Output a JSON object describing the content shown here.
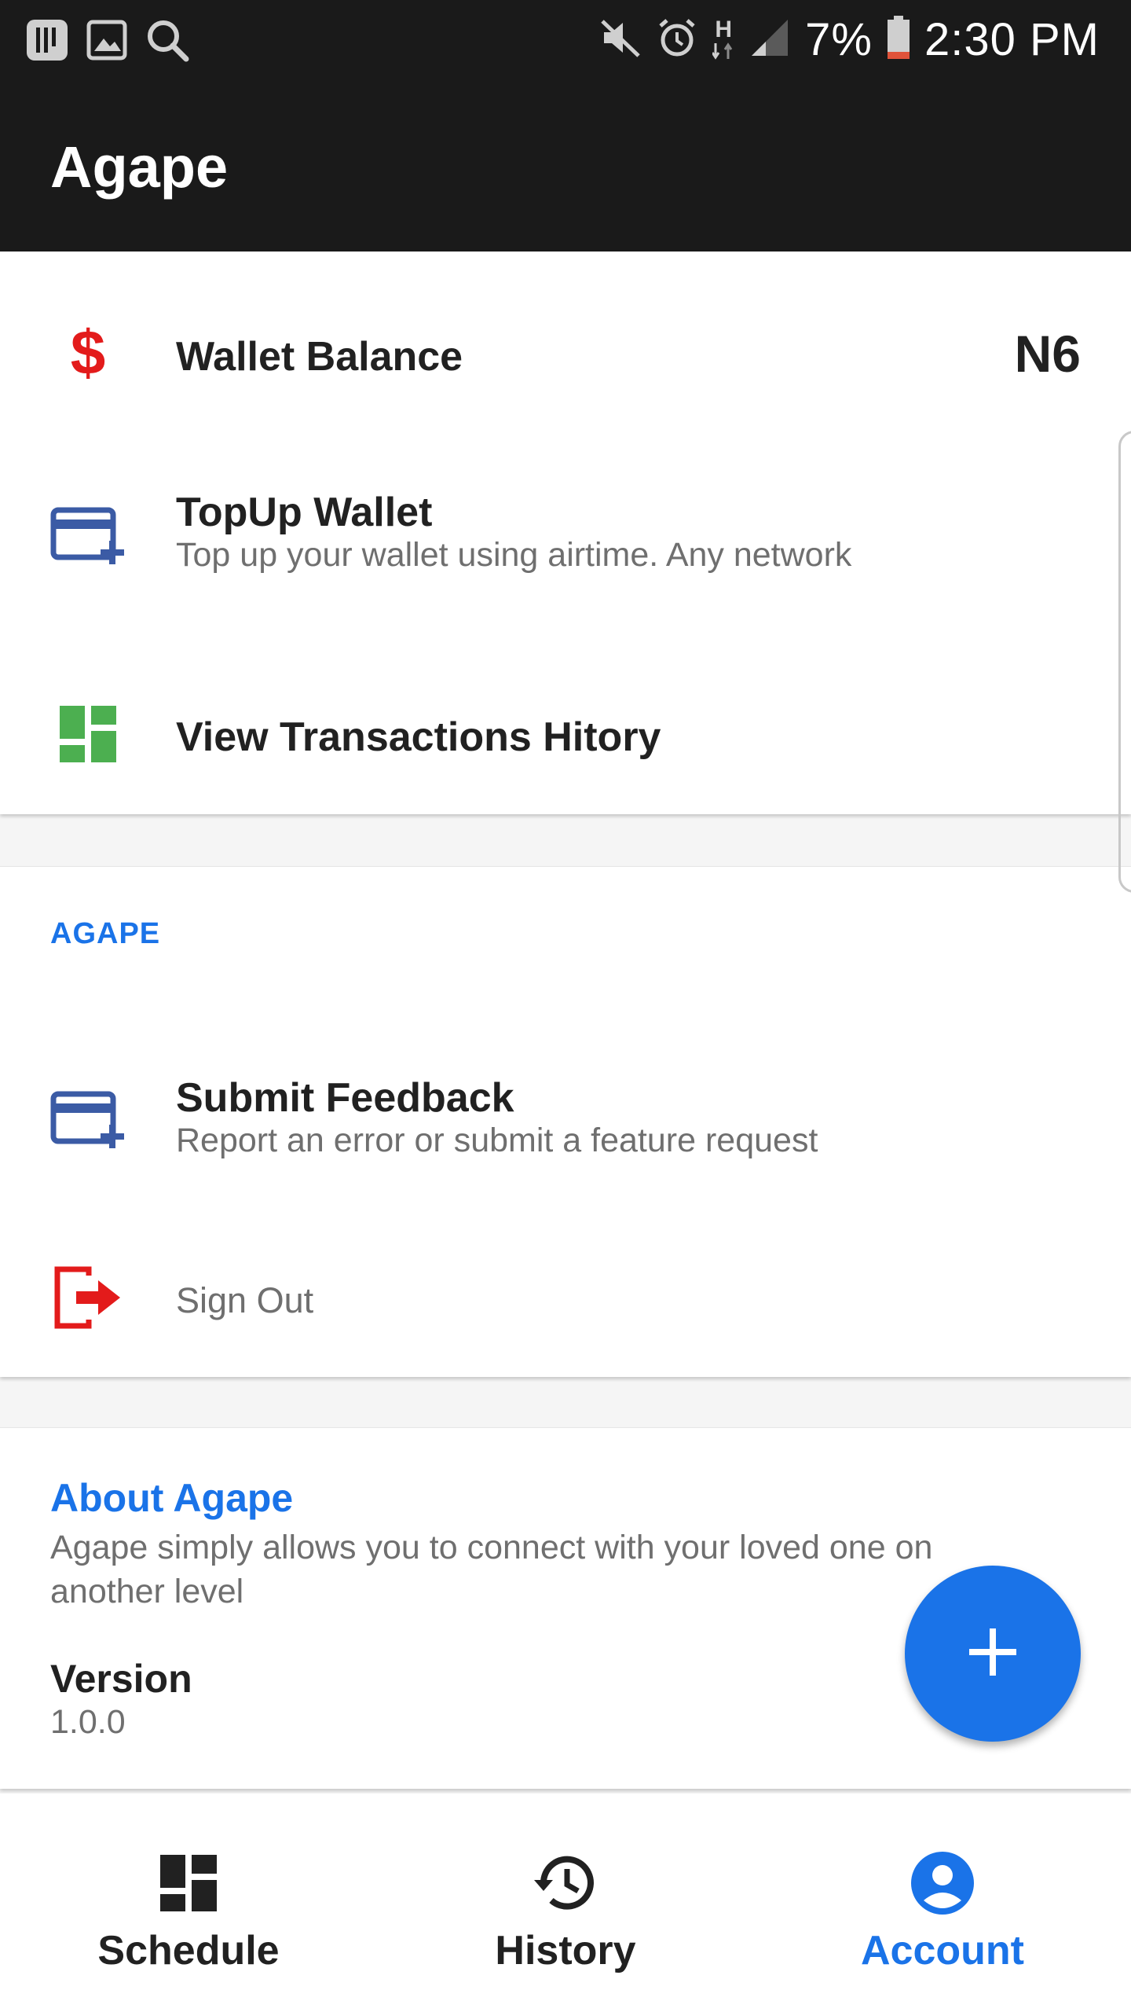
{
  "status_bar": {
    "battery": "7%",
    "time": "2:30 PM",
    "network_label": "H"
  },
  "app": {
    "title": "Agape"
  },
  "account_card": {
    "wallet_balance_label": "Wallet Balance",
    "wallet_balance_value": "N6",
    "topup_title": "TopUp Wallet",
    "topup_subtitle": "Top up your wallet using airtime. Any network",
    "transactions_title": "View Transactions Hitory"
  },
  "agape_section": {
    "header": "AGAPE",
    "feedback_title": "Submit Feedback",
    "feedback_subtitle": "Report an error or submit a feature request",
    "signout_label": "Sign Out"
  },
  "about_card": {
    "title": "About Agape",
    "description": "Agape simply allows you to connect with your loved one on another level",
    "version_label": "Version",
    "version_value": "1.0.0"
  },
  "bottom_nav": {
    "items": [
      {
        "label": "Schedule",
        "icon": "dashboard-icon",
        "active": false
      },
      {
        "label": "History",
        "icon": "history-icon",
        "active": false
      },
      {
        "label": "Account",
        "icon": "account-circle-icon",
        "active": true
      }
    ]
  },
  "colors": {
    "accent": "#1a73e8",
    "dollar": "#e31b1b",
    "card_icon": "#3b5ba5",
    "grid_icon": "#4caf50",
    "signout_icon": "#e31b1b",
    "appbar": "#1a1a1a"
  }
}
